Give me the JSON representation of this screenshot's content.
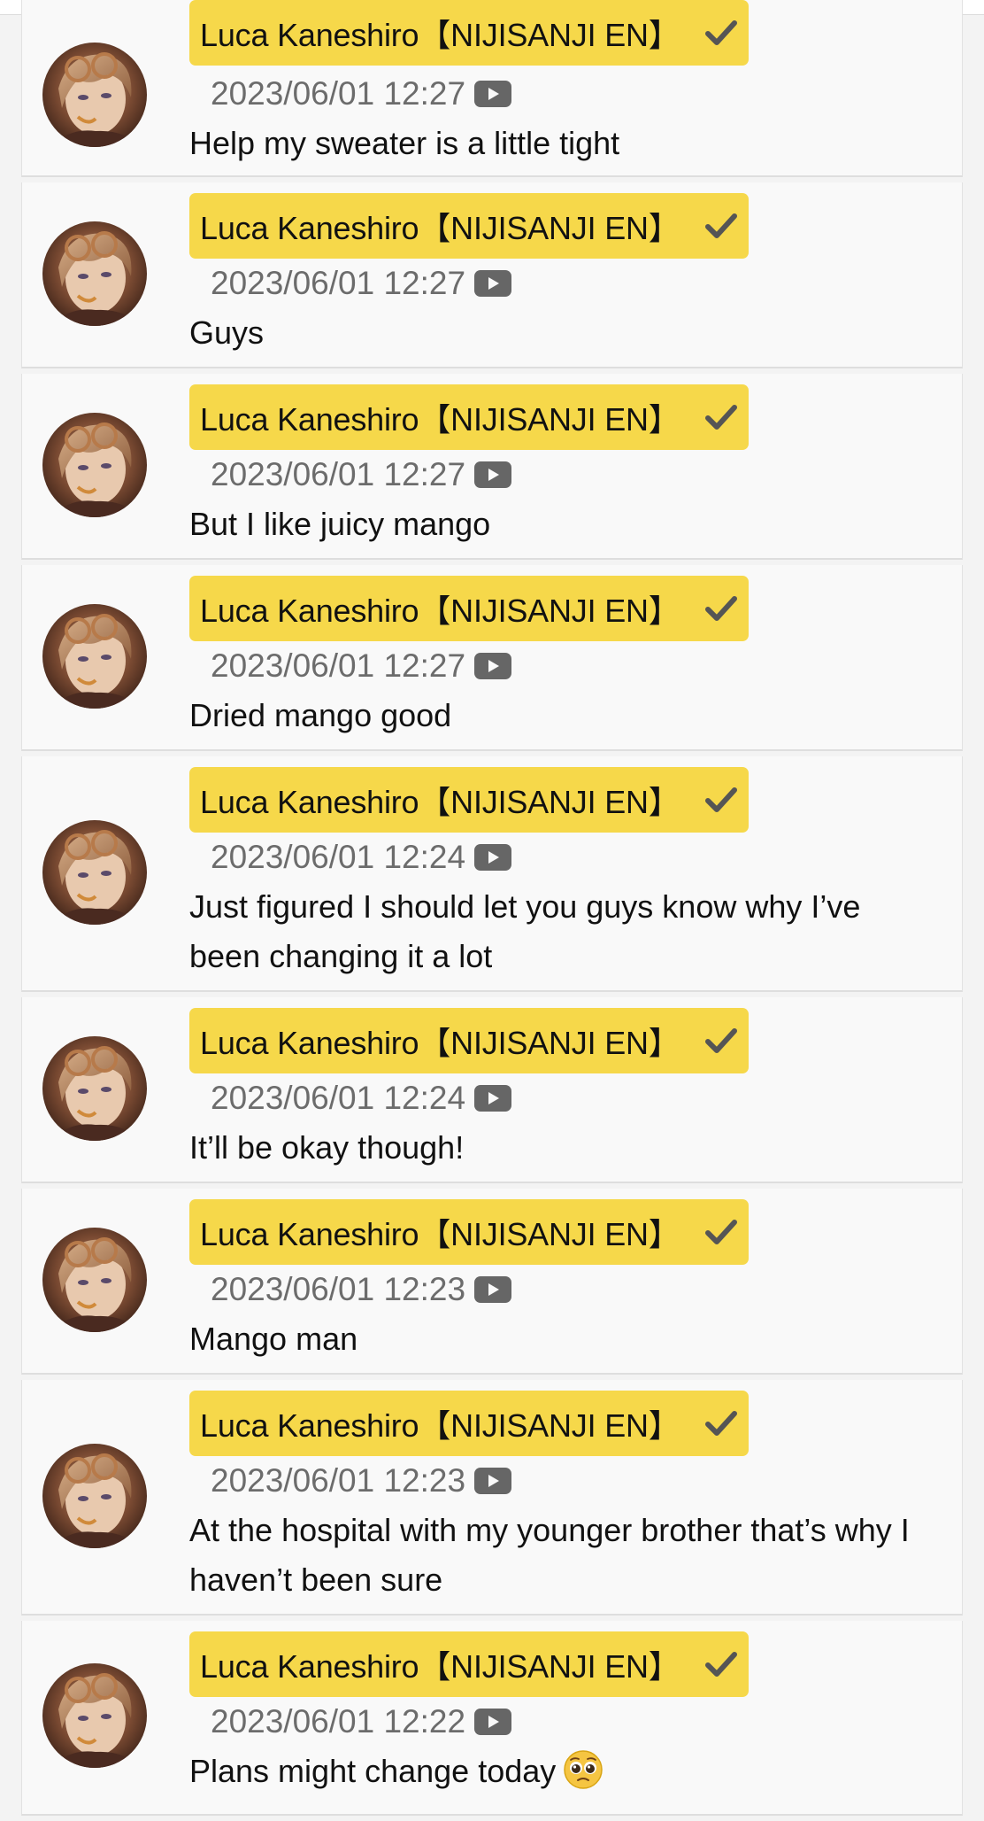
{
  "messages": [
    {
      "author": "Luca Kaneshiro【NIJISANJI EN】",
      "timestamp": "2023/06/01 12:27",
      "text": "Help my sweater is a little tight"
    },
    {
      "author": "Luca Kaneshiro【NIJISANJI EN】",
      "timestamp": "2023/06/01 12:27",
      "text": "Guys"
    },
    {
      "author": "Luca Kaneshiro【NIJISANJI EN】",
      "timestamp": "2023/06/01 12:27",
      "text": "But I like juicy mango"
    },
    {
      "author": "Luca Kaneshiro【NIJISANJI EN】",
      "timestamp": "2023/06/01 12:27",
      "text": "Dried mango good"
    },
    {
      "author": "Luca Kaneshiro【NIJISANJI EN】",
      "timestamp": "2023/06/01 12:24",
      "text": "Just figured I should let you guys know why I’ve been changing it a lot"
    },
    {
      "author": "Luca Kaneshiro【NIJISANJI EN】",
      "timestamp": "2023/06/01 12:24",
      "text": "It’ll be okay though!"
    },
    {
      "author": "Luca Kaneshiro【NIJISANJI EN】",
      "timestamp": "2023/06/01 12:23",
      "text": "Mango man"
    },
    {
      "author": "Luca Kaneshiro【NIJISANJI EN】",
      "timestamp": "2023/06/01 12:23",
      "text": "At the hospital with my younger brother that’s why I haven’t been sure"
    },
    {
      "author": "Luca Kaneshiro【NIJISANJI EN】",
      "timestamp": "2023/06/01 12:22",
      "text": "Plans might change today",
      "emoji": "pleading-face-emoji"
    }
  ],
  "icons": {
    "verified": "checkmark-icon",
    "platform": "youtube-icon"
  },
  "colors": {
    "author_chip": "#f6d84a",
    "timestamp": "#6c6c6c",
    "card_background": "#f9f9f9"
  }
}
